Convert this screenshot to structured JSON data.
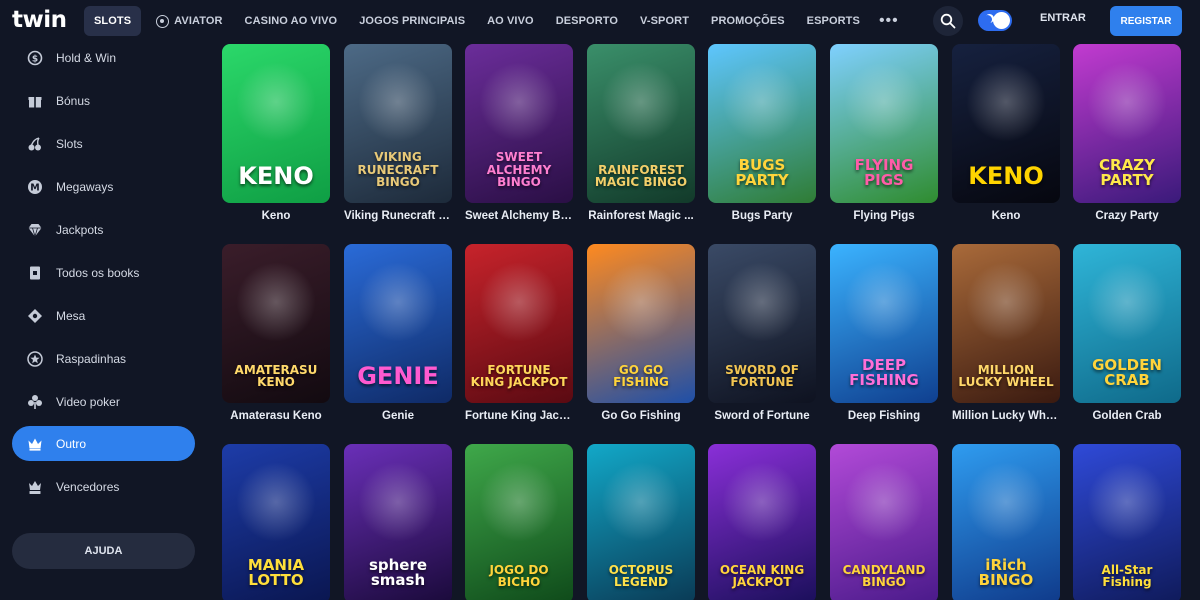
{
  "brand": {
    "logo_text": "twin"
  },
  "header": {
    "nav": [
      {
        "label": "SLOTS",
        "active": true
      },
      {
        "label": "AVIATOR",
        "icon": "aviator-icon"
      },
      {
        "label": "CASINO AO VIVO"
      },
      {
        "label": "JOGOS PRINCIPAIS"
      },
      {
        "label": "AO VIVO"
      },
      {
        "label": "DESPORTO"
      },
      {
        "label": "V-SPORT"
      },
      {
        "label": "PROMOÇÕES"
      },
      {
        "label": "ESPORTS"
      }
    ],
    "more_label": "•••",
    "login_label": "ENTRAR",
    "register_label": "REGISTAR",
    "accent": "#2f80ed"
  },
  "sidebar": {
    "items": [
      {
        "label": "Hold & Win",
        "icon": "coin-icon",
        "active": false
      },
      {
        "label": "Bónus",
        "icon": "gift-icon",
        "active": false
      },
      {
        "label": "Slots",
        "icon": "cherries-icon",
        "active": false
      },
      {
        "label": "Megaways",
        "icon": "megaways-icon",
        "active": false
      },
      {
        "label": "Jackpots",
        "icon": "diamond-icon",
        "active": false
      },
      {
        "label": "Todos os books",
        "icon": "book-icon",
        "active": false
      },
      {
        "label": "Mesa",
        "icon": "chip-icon",
        "active": false
      },
      {
        "label": "Raspadinhas",
        "icon": "scratch-card-icon",
        "active": false
      },
      {
        "label": "Video poker",
        "icon": "clubs-icon",
        "active": false
      },
      {
        "label": "Outro",
        "icon": "crown-icon",
        "active": true
      },
      {
        "label": "Vencedores",
        "icon": "winners-icon",
        "active": false
      }
    ],
    "help_label": "AJUDA"
  },
  "games": [
    {
      "name": "Keno",
      "art": "KENO",
      "bg": [
        "#2bd86a",
        "#0f9e44"
      ],
      "fg": "#ffffff"
    },
    {
      "name": "Viking Runecraft B...",
      "art": "VIKING RUNECRAFT BINGO",
      "bg": [
        "#4d6a86",
        "#1d2a3a"
      ],
      "fg": "#e8c978"
    },
    {
      "name": "Sweet Alchemy Bi...",
      "art": "SWEET ALCHEMY BINGO",
      "bg": [
        "#6b2d9a",
        "#2a0f45"
      ],
      "fg": "#ff7fd0"
    },
    {
      "name": "Rainforest Magic ...",
      "art": "RAINFOREST MAGIC BINGO",
      "bg": [
        "#3a8f6a",
        "#123a2a"
      ],
      "fg": "#f3cf6a"
    },
    {
      "name": "Bugs Party",
      "art": "BUGS PARTY",
      "bg": [
        "#5ec6ff",
        "#2f7c34"
      ],
      "fg": "#ffd43b"
    },
    {
      "name": "Flying Pigs",
      "art": "FLYING PIGS",
      "bg": [
        "#7fd0ff",
        "#2f8c2f"
      ],
      "fg": "#ff5ca8"
    },
    {
      "name": "Keno",
      "art": "KENO",
      "bg": [
        "#16213f",
        "#06070f"
      ],
      "fg": "#ffd400"
    },
    {
      "name": "Crazy Party",
      "art": "CRAZY PARTY",
      "bg": [
        "#c23bd0",
        "#3a1a7a"
      ],
      "fg": "#ffe94a"
    },
    {
      "name": "Amaterasu Keno",
      "art": "AMATERASU KENO",
      "bg": [
        "#3a1d2a",
        "#120a10"
      ],
      "fg": "#ffd96b"
    },
    {
      "name": "Genie",
      "art": "GENIE",
      "bg": [
        "#2a6bd8",
        "#0f2a66"
      ],
      "fg": "#ff5ad0"
    },
    {
      "name": "Fortune King Jack...",
      "art": "FORTUNE KING JACKPOT",
      "bg": [
        "#c7232b",
        "#5a0a12"
      ],
      "fg": "#ffd75a"
    },
    {
      "name": "Go Go Fishing",
      "art": "GO GO FISHING",
      "bg": [
        "#ff8a1f",
        "#1e4fa8"
      ],
      "fg": "#ffd43b"
    },
    {
      "name": "Sword of Fortune",
      "art": "SWORD OF FORTUNE",
      "bg": [
        "#3a4a66",
        "#0e1220"
      ],
      "fg": "#f2c552"
    },
    {
      "name": "Deep Fishing",
      "art": "DEEP FISHING",
      "bg": [
        "#3bb3ff",
        "#0f3f8f"
      ],
      "fg": "#ff6fd8"
    },
    {
      "name": "Million Lucky Wheel",
      "art": "MILLION LUCKY WHEEL",
      "bg": [
        "#a96a3a",
        "#3a1a10"
      ],
      "fg": "#ffd86a"
    },
    {
      "name": "Golden Crab",
      "art": "GOLDEN CRAB",
      "bg": [
        "#2fb5d8",
        "#0f6a8a"
      ],
      "fg": "#ffd43b"
    },
    {
      "name": "",
      "art": "MANIA LOTTO",
      "bg": [
        "#1d3ca8",
        "#0a1650"
      ],
      "fg": "#ffdf3b"
    },
    {
      "name": "",
      "art": "sphere smash",
      "bg": [
        "#6a2fb8",
        "#1a0a3a"
      ],
      "fg": "#ffffff"
    },
    {
      "name": "",
      "art": "JOGO DO BICHO",
      "bg": [
        "#3fa84a",
        "#0f4a1a"
      ],
      "fg": "#ffd43b"
    },
    {
      "name": "",
      "art": "OCTOPUS LEGEND",
      "bg": [
        "#12a8c8",
        "#0a3a55"
      ],
      "fg": "#ffe14a"
    },
    {
      "name": "",
      "art": "OCEAN KING JACKPOT",
      "bg": [
        "#8a2fd8",
        "#1a0f5a"
      ],
      "fg": "#ffd43b"
    },
    {
      "name": "",
      "art": "CANDYLAND BINGO",
      "bg": [
        "#b24ad8",
        "#4a1a8a"
      ],
      "fg": "#ffd43b"
    },
    {
      "name": "",
      "art": "iRich BINGO",
      "bg": [
        "#2f9cf0",
        "#0f3a8a"
      ],
      "fg": "#ffd43b"
    },
    {
      "name": "",
      "art": "All-Star Fishing",
      "bg": [
        "#2f4ad8",
        "#0f1a5a"
      ],
      "fg": "#ffdf3b"
    }
  ]
}
